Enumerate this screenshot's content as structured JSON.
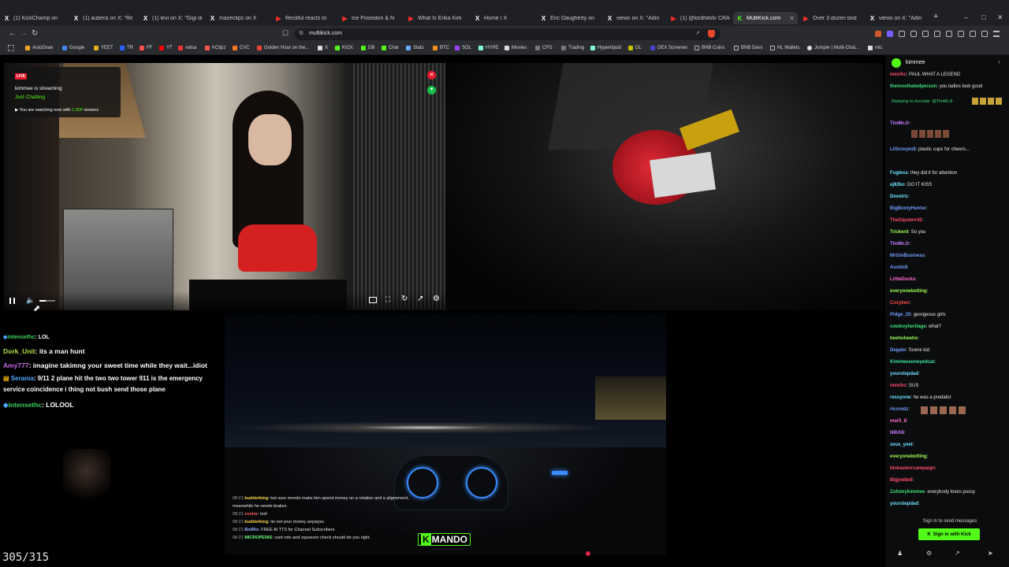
{
  "browser": {
    "tabs": [
      {
        "icon": "x-icon",
        "label": "(1) KickChamp on"
      },
      {
        "icon": "x-icon",
        "label": "(1) aubera on X: \"Resu"
      },
      {
        "icon": "x-icon",
        "label": "(1) levi on X: \"Gigi dro"
      },
      {
        "icon": "x-icon",
        "label": "mazeclips on X"
      },
      {
        "icon": "youtube-icon",
        "label": "Reckful reacts to"
      },
      {
        "icon": "youtube-icon",
        "label": "Ice Poseidon & N"
      },
      {
        "icon": "youtube-icon",
        "label": "What Is Erika Kirk"
      },
      {
        "icon": "x-icon",
        "label": "Home / X"
      },
      {
        "icon": "x-icon",
        "label": "Eric Daugherty on"
      },
      {
        "icon": "x-icon",
        "label": "views on X: \"Adin"
      },
      {
        "icon": "youtube-icon",
        "label": "(1) @lordhitotv CRASH"
      },
      {
        "icon": "kick-icon",
        "label": "MultiKick.com"
      },
      {
        "icon": "youtube-icon",
        "label": "Over 3 dozen bod"
      },
      {
        "icon": "x-icon",
        "label": "views on X: \"Adin"
      }
    ],
    "url": "multikick.com",
    "bookmarks": [
      "AutoDraw",
      "Google",
      "YEET",
      "TR",
      "FF",
      "YT",
      "vatsa",
      "KClipz",
      "CVC",
      "Golden Hour on the...",
      "X",
      "KICK",
      "DB",
      "Chat",
      "Stats",
      "BTC",
      "SOL",
      "HYPE",
      "Movies",
      "CFG",
      "Trading",
      "Hyperliquid",
      "DL",
      "DEX Screener",
      "BNB Coins",
      "BNB Devs",
      "HL Wallets",
      "Jumper | Multi-Chai...",
      "mic"
    ]
  },
  "player1": {
    "live_badge": "LIVE",
    "streamer_status": "kimmee is streaming",
    "category": "Just Chatting",
    "watching_prefix": "You are watching now with",
    "viewer_count": "1,506",
    "viewers_suffix": "viewers",
    "volume": 0.4
  },
  "overlay_chat": [
    {
      "user": "intensethc",
      "text": ": LOL",
      "color": "#3ecf5c"
    },
    {
      "user": "Dork_Unit",
      "text": ": its a man hunt",
      "color": "#b4e04a"
    },
    {
      "user": "Amy777",
      "text": ": imagine takimng your sweet time while they wait...idiot",
      "color": "#c46be6"
    },
    {
      "user": "Serania",
      "text": ": 9/11 2 plane hit the two two tower 911 is the emergency service coincidence i thing not bush send those plane",
      "color": "#4ea8ff"
    },
    {
      "user": "intensethc",
      "text": ": LOLOOL",
      "color": "#3ecf5c"
    }
  ],
  "page_counter": "305/315",
  "video3_chat": [
    {
      "time": "08:21",
      "user": "budderking",
      "text": ": but sure mondo make him spend money on a rotation and a alignement, meanwhile he needs brakes",
      "color": "#ffd84a"
    },
    {
      "time": "08:21",
      "user": "zootor",
      "text": ": lool",
      "color": "#ff5a5a"
    },
    {
      "time": "08:21",
      "user": "budderking",
      "text": ": its not your money anywyss",
      "color": "#ffd84a"
    },
    {
      "time": "08:21",
      "user": "BotRix",
      "text": ": FREE AI TTS for Channel Subscribers",
      "color": "#9bb0ff"
    },
    {
      "time": "08:21",
      "user": "MICROPENIS",
      "text": ": cunt roto and squeezer check should do you right.",
      "color": "#6bff7a"
    }
  ],
  "video3_logo": "MANDO",
  "chat": {
    "channel": "kimmee",
    "messages": [
      {
        "user": "mexihc",
        "text": "PAUL WHAT A LEGEND",
        "color": "#ff4d6d"
      },
      {
        "user": "themosthatedperson",
        "text": "you ladies look good",
        "color": "#3ee07a"
      },
      {
        "user": "",
        "text": "Replying to riccrodz: @TimMcJr",
        "color": "#3ee07a"
      },
      {
        "user": "TimMcJr",
        "text": "",
        "color": "#c77dff"
      },
      {
        "user": "LilScorpio8",
        "text": "plastic cups for cheers...",
        "color": "#6f9dff"
      },
      {
        "user": "Fugless",
        "text": "they did it for attention",
        "color": "#6be0ff"
      },
      {
        "user": "ej82ko",
        "text": "DO IT KISS",
        "color": "#6be0ff"
      },
      {
        "user": "Develric",
        "text": "",
        "color": "#6be0ff"
      },
      {
        "user": "BigBootyHunter",
        "text": "",
        "color": "#6f9dff"
      },
      {
        "user": "TheGipsterr42",
        "text": "",
        "color": "#ff4d6d"
      },
      {
        "user": "Trickerd",
        "text": "So you",
        "color": "#9cff57"
      },
      {
        "user": "TimMcJr",
        "text": "",
        "color": "#c77dff"
      },
      {
        "user": "MrGinBusiness",
        "text": "",
        "color": "#6f9dff"
      },
      {
        "user": "Austin9",
        "text": "",
        "color": "#6f9dff"
      },
      {
        "user": "LittleDucks",
        "text": "",
        "color": "#ff6ad5"
      },
      {
        "user": "everyonebotting",
        "text": "",
        "color": "#9cff57"
      },
      {
        "user": "Cozyken",
        "text": "",
        "color": "#ff4d4d"
      },
      {
        "user": "Pidge_25",
        "text": "georgeous girls",
        "color": "#6f9dff"
      },
      {
        "user": "cowboyheritage",
        "text": "what?",
        "color": "#3ee07a"
      },
      {
        "user": "heehoheeho",
        "text": "",
        "color": "#9cff57"
      },
      {
        "user": "Degato",
        "text": "Scene kid",
        "color": "#6f9dff"
      },
      {
        "user": "Kimmeesoneyedcat",
        "text": "",
        "color": "#3ee0a0"
      },
      {
        "user": "yourstepdad",
        "text": "",
        "color": "#6be0ff"
      },
      {
        "user": "mexihc",
        "text": "SUS",
        "color": "#ff4d6d"
      },
      {
        "user": "ressyone",
        "text": "he was a predator",
        "color": "#6be0ff"
      },
      {
        "user": "riccrodz",
        "text": "",
        "color": "#6f9dff"
      },
      {
        "user": "mar5_8",
        "text": "",
        "color": "#ff6ad5"
      },
      {
        "user": "NIKK8",
        "text": "",
        "color": "#c77dff"
      },
      {
        "user": "zeus_yeet",
        "text": "",
        "color": "#6be0ff"
      },
      {
        "user": "everyonebotting",
        "text": "",
        "color": "#9cff57"
      },
      {
        "user": "blokasterrcampaign",
        "text": "",
        "color": "#ff4d6d"
      },
      {
        "user": "Bigjoe8o8",
        "text": "",
        "color": "#ff4d6d"
      },
      {
        "user": "Zofomykimmee",
        "text": "everybody loves pussy",
        "color": "#3ee07a"
      },
      {
        "user": "yourstepdad",
        "text": "",
        "color": "#6be0ff"
      }
    ],
    "sign_in_prompt": "Sign in to send messages",
    "sign_in_button": "Sign in with Kick"
  }
}
